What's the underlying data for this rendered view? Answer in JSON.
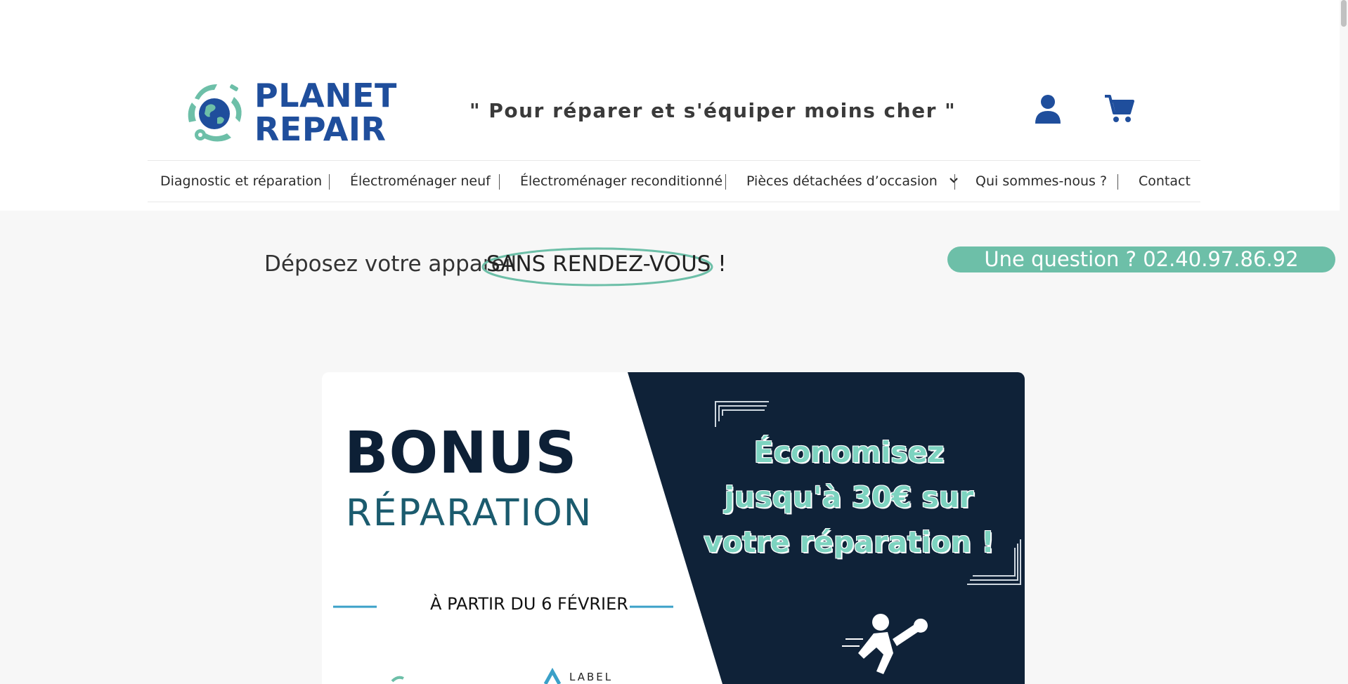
{
  "brand": {
    "name_line1": "PLANET",
    "name_line2": "REPAIR",
    "tagline": "\" Pour réparer et s'équiper moins cher \"",
    "primary_color": "#1f4e9c",
    "accent_color": "#6dbfa8"
  },
  "header_icons": {
    "account": "user-icon",
    "cart": "cart-icon"
  },
  "nav": {
    "items": [
      {
        "label": "Diagnostic et réparation"
      },
      {
        "label": "Électroménager neuf"
      },
      {
        "label": "Électroménager reconditionné"
      },
      {
        "label": "Pièces détachées d’occasion",
        "has_dropdown": true
      },
      {
        "label": "Qui sommes-nous ?"
      },
      {
        "label": "Contact"
      }
    ]
  },
  "promo": {
    "text": "Déposez votre appareil",
    "highlight": "SANS RENDEZ-VOUS !",
    "phone_label": "Une question ? 02.40.97.86.92"
  },
  "banner": {
    "title": "BONUS",
    "subtitle": "RÉPARATION",
    "date": "À PARTIR DU 6 FÉVRIER",
    "save_line1": "Économisez",
    "save_line2": "jusqu'à 30€ sur",
    "save_line3": "votre réparation !",
    "label_text": "LABEL",
    "dark_color": "#0f2238",
    "teal_color": "#7dd3c0"
  }
}
